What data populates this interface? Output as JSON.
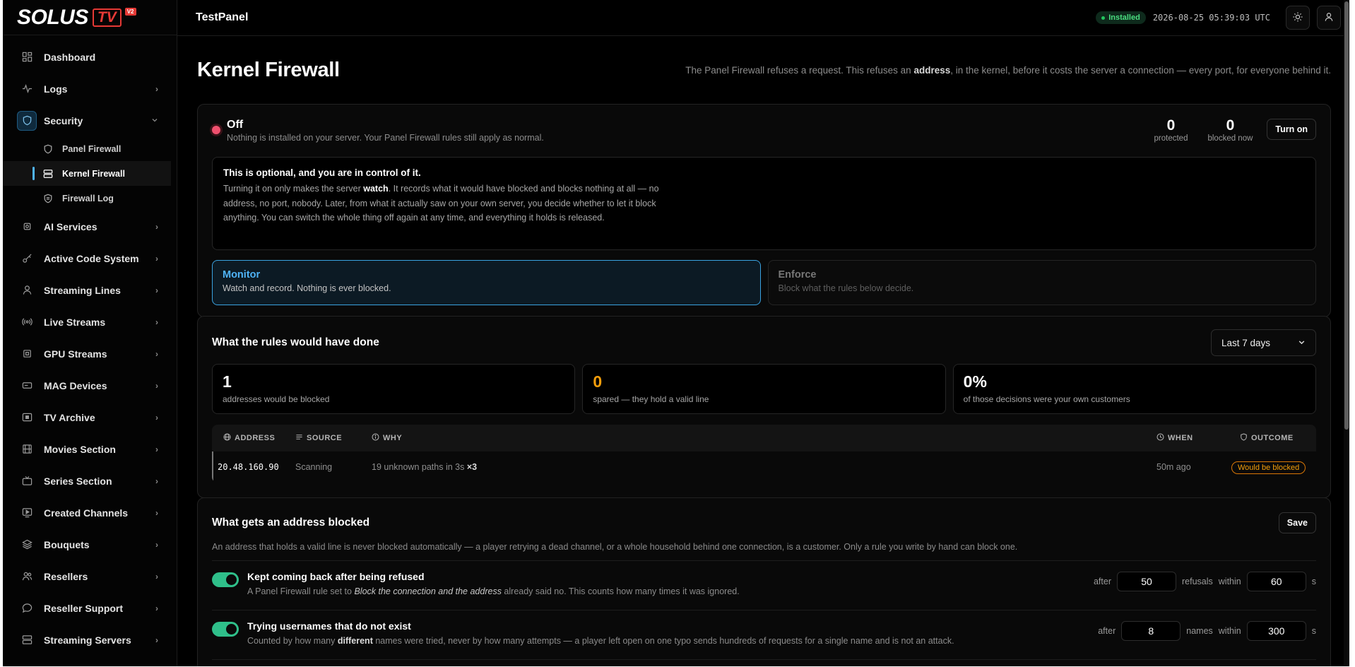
{
  "logo": {
    "text": "SOLUS",
    "tv": "TV",
    "version": "V2"
  },
  "sidebar": {
    "items": [
      {
        "label": "Dashboard",
        "icon": "grid-icon"
      },
      {
        "label": "Logs",
        "icon": "activity-icon"
      },
      {
        "label": "Security",
        "icon": "shield-icon"
      },
      {
        "label": "AI Services",
        "icon": "chip-icon"
      },
      {
        "label": "Active Code System",
        "icon": "key-icon"
      },
      {
        "label": "Streaming Lines",
        "icon": "user-icon"
      },
      {
        "label": "Live Streams",
        "icon": "broadcast-icon"
      },
      {
        "label": "GPU Streams",
        "icon": "cpu-icon"
      },
      {
        "label": "MAG Devices",
        "icon": "device-icon"
      },
      {
        "label": "TV Archive",
        "icon": "archive-icon"
      },
      {
        "label": "Movies Section",
        "icon": "film-icon"
      },
      {
        "label": "Series Section",
        "icon": "tv-icon"
      },
      {
        "label": "Created Channels",
        "icon": "play-screen-icon"
      },
      {
        "label": "Bouquets",
        "icon": "layers-icon"
      },
      {
        "label": "Resellers",
        "icon": "users-icon"
      },
      {
        "label": "Reseller Support",
        "icon": "chat-icon"
      },
      {
        "label": "Streaming Servers",
        "icon": "server-icon"
      }
    ],
    "security_sub": [
      {
        "label": "Panel Firewall",
        "icon": "shield-icon"
      },
      {
        "label": "Kernel Firewall",
        "icon": "server-icon"
      },
      {
        "label": "Firewall Log",
        "icon": "shield-log-icon"
      }
    ]
  },
  "topbar": {
    "panel_name": "TestPanel",
    "installed": "Installed",
    "clock": "2026-08-25 05:39:03 UTC"
  },
  "page": {
    "title": "Kernel Firewall",
    "desc_pre": "The Panel Firewall refuses a request. This refuses an ",
    "desc_bold": "address",
    "desc_post": ", in the kernel, before it costs the server a connection — every port, for everyone behind it."
  },
  "status": {
    "title": "Off",
    "sub": "Nothing is installed on your server. Your Panel Firewall rules still apply as normal.",
    "protected_num": "0",
    "protected_label": "protected",
    "blocked_num": "0",
    "blocked_label": "blocked now",
    "turn_on": "Turn on",
    "info_title": "This is optional, and you are in control of it.",
    "info_pre": "Turning it on only makes the server ",
    "info_bold": "watch",
    "info_post": ". It records what it would have blocked and blocks nothing at all — no address, no port, nobody. Later, from what it actually saw on your own server, you decide whether to let it block anything. You can switch the whole thing off again at any time, and everything it holds is released.",
    "monitor_title": "Monitor",
    "monitor_sub": "Watch and record. Nothing is ever blocked.",
    "enforce_title": "Enforce",
    "enforce_sub": "Block what the rules below decide."
  },
  "rules_done": {
    "title": "What the rules would have done",
    "range": "Last 7 days",
    "kpis": [
      {
        "num": "1",
        "cap": "addresses would be blocked"
      },
      {
        "num": "0",
        "cap": "spared — they hold a valid line"
      },
      {
        "num": "0%",
        "cap": "of those decisions were your own customers"
      }
    ],
    "headers": {
      "address": "ADDRESS",
      "source": "SOURCE",
      "why": "WHY",
      "when": "WHEN",
      "outcome": "OUTCOME"
    },
    "row": {
      "address": "20.48.160.90",
      "source": "Scanning",
      "why": "19 unknown paths in 3s",
      "mult": "×3",
      "when": "50m ago",
      "outcome": "Would be blocked"
    }
  },
  "blocked": {
    "title": "What gets an address blocked",
    "save": "Save",
    "desc": "An address that holds a valid line is never blocked automatically — a player retrying a dead channel, or a whole household behind one connection, is a customer. Only a rule you write by hand can block one.",
    "rule1": {
      "title": "Kept coming back after being refused",
      "sub_pre": "A Panel Firewall rule set to ",
      "sub_italic": "Block the connection and the address",
      "sub_post": " already said no. This counts how many times it was ignored.",
      "after": "after",
      "count": "50",
      "unit": "refusals",
      "within": "within",
      "window": "60",
      "s": "s"
    },
    "rule2": {
      "title": "Trying usernames that do not exist",
      "sub_pre": "Counted by how many ",
      "sub_bold": "different",
      "sub_post": " names were tried, never by how many attempts — a player left open on one typo sends hundreds of requests for a single name and is not an attack.",
      "after": "after",
      "count": "8",
      "unit": "names",
      "within": "within",
      "window": "300",
      "s": "s"
    }
  },
  "colors": {
    "accent": "#4fb3f6",
    "danger": "#f0506e",
    "warning": "#f59e0b",
    "success": "#2fbf8a"
  }
}
